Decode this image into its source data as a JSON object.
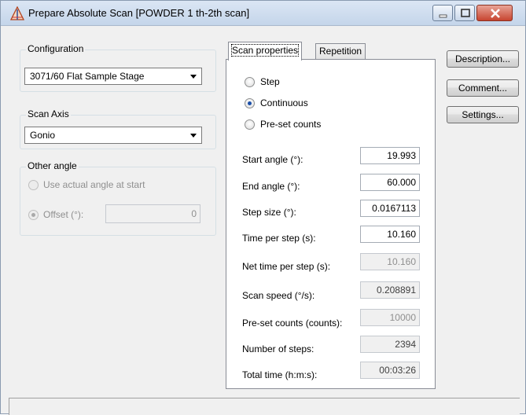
{
  "window": {
    "title": "Prepare Absolute Scan [POWDER 1 th-2th scan]"
  },
  "configuration": {
    "group_title": "Configuration",
    "selected": "3071/60 Flat Sample Stage"
  },
  "scan_axis": {
    "group_title": "Scan Axis",
    "selected": "Gonio"
  },
  "other_angle": {
    "group_title": "Other angle",
    "use_actual_label": "Use actual angle at start",
    "offset_label": "Offset (°):",
    "offset_value": "0"
  },
  "tabs": {
    "scan_properties": "Scan properties",
    "repetition": "Repetition"
  },
  "scan_mode": {
    "step": "Step",
    "continuous": "Continuous",
    "preset_counts": "Pre-set counts",
    "selected": "continuous"
  },
  "properties": [
    {
      "label": "Start angle (°):",
      "value": "19.993",
      "state": "editable"
    },
    {
      "label": "End angle (°):",
      "value": "60.000",
      "state": "editable"
    },
    {
      "label": "Step size (°):",
      "value": "0.0167113",
      "state": "editable"
    },
    {
      "label": "Time per step (s):",
      "value": "10.160",
      "state": "editable"
    },
    {
      "label": "Net time per step (s):",
      "value": "10.160",
      "state": "disabled"
    },
    {
      "label": "Scan speed (°/s):",
      "value": "0.208891",
      "state": "readonly"
    },
    {
      "label": "Pre-set counts (counts):",
      "value": "10000",
      "state": "disabled"
    },
    {
      "label": "Number of steps:",
      "value": "2394",
      "state": "readonly"
    },
    {
      "label": "Total time (h:m:s):",
      "value": "00:03:26",
      "state": "readonly"
    }
  ],
  "buttons": {
    "description": "Description...",
    "comment": "Comment...",
    "settings": "Settings..."
  }
}
